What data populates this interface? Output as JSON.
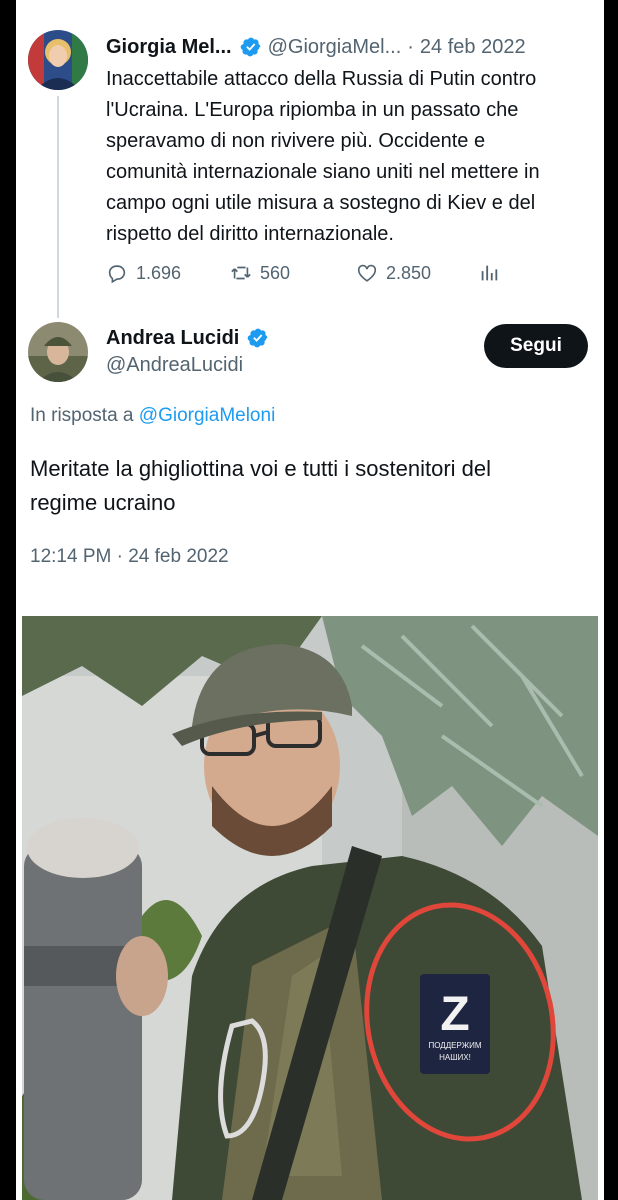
{
  "parent_tweet": {
    "name": "Giorgia Mel...",
    "handle": "@GiorgiaMel...",
    "separator": "·",
    "date": "24 feb 2022",
    "lines": [
      "Inaccettabile attacco della Russia di Putin contro",
      "l'Ucraina. L'Europa ripiomba in un passato che",
      "speravamo di non rivivere più. Occidente e",
      "comunità internazionale siano uniti nel mettere in",
      "campo ogni utile misura a sostegno di Kiev e del",
      "rispetto del diritto internazionale."
    ],
    "stats": {
      "replies": "1.696",
      "retweets": "560",
      "likes": "2.850"
    },
    "icons": [
      "reply-icon",
      "retweet-icon",
      "like-icon",
      "views-icon"
    ]
  },
  "reply_tweet": {
    "name": "Andrea Lucidi",
    "handle": "@AndreaLucidi",
    "follow_label": "Segui",
    "in_reply_prefix": "In risposta a",
    "in_reply_handle": "@GiorgiaMeloni",
    "lines": [
      "Meritate la ghigliottina voi e tutti i sostenitori del",
      "regime ucraino"
    ],
    "time": "12:14 PM",
    "separator": "·",
    "date": "24 feb 2022"
  },
  "photo": {
    "patch_letter": "Z",
    "patch_caption_1": "ПОДДЕРЖИМ",
    "patch_caption_2": "НАШИХ!"
  },
  "colors": {
    "verified_blue": "#1d9bf0",
    "link_blue": "#1d9bf0",
    "muted_text": "#536471",
    "follow_button_bg": "#0f1419",
    "highlight_circle": "#e0463a"
  }
}
